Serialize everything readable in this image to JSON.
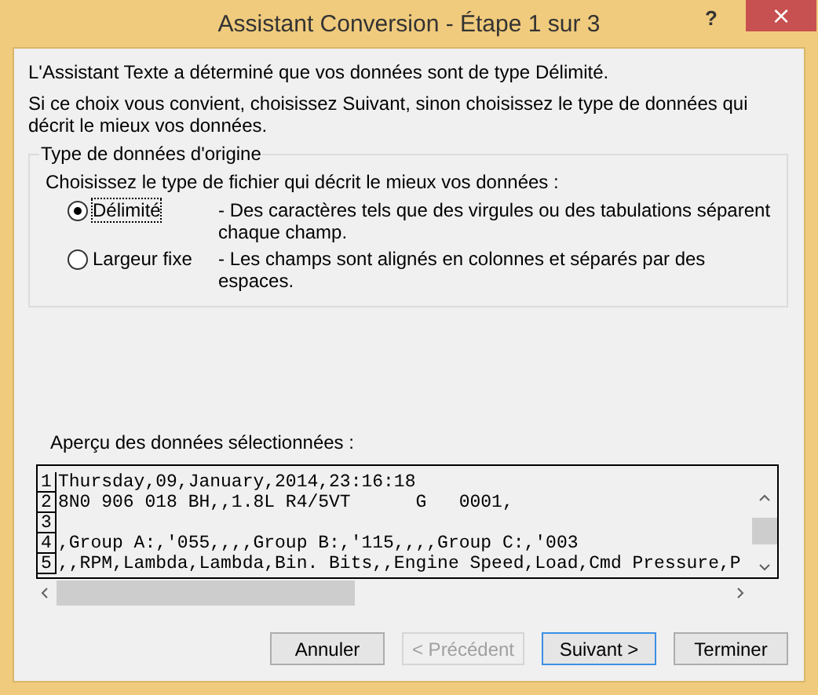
{
  "window": {
    "title": "Assistant Conversion - Étape 1 sur 3",
    "help": "?",
    "close": "×"
  },
  "intro": "L'Assistant Texte a déterminé que vos données sont de type Délimité.",
  "hint": "Si ce choix vous convient, choisissez Suivant, sinon choisissez le type de données qui décrit le mieux vos données.",
  "group": {
    "title": "Type de données d'origine",
    "prompt": "Choisissez le type de fichier qui décrit le mieux vos données :",
    "options": [
      {
        "label": "Délimité",
        "description": "- Des caractères tels que des virgules ou des tabulations séparent chaque champ.",
        "selected": true
      },
      {
        "label": "Largeur fixe",
        "description": "- Les champs sont alignés en colonnes et séparés par des espaces.",
        "selected": false
      }
    ]
  },
  "preview": {
    "label": "Aperçu des données sélectionnées :",
    "rows": [
      {
        "number": "1",
        "text": "Thursday,09,January,2014,23:16:18"
      },
      {
        "number": "2",
        "text": "8N0 906 018 BH,,1.8L R4/5VT      G   0001,"
      },
      {
        "number": "3",
        "text": ""
      },
      {
        "number": "4",
        "text": ",Group A:,'055,,,,Group B:,'115,,,,Group C:,'003"
      },
      {
        "number": "5",
        "text": ",,RPM,Lambda,Lambda,Bin. Bits,,Engine Speed,Load,Cmd Pressure,P"
      }
    ]
  },
  "buttons": [
    {
      "label": "Annuler",
      "disabled": false,
      "default": false
    },
    {
      "label": "< Précédent",
      "disabled": true,
      "default": false
    },
    {
      "label": "Suivant >",
      "disabled": false,
      "default": true
    },
    {
      "label": "Terminer",
      "disabled": false,
      "default": false
    }
  ]
}
